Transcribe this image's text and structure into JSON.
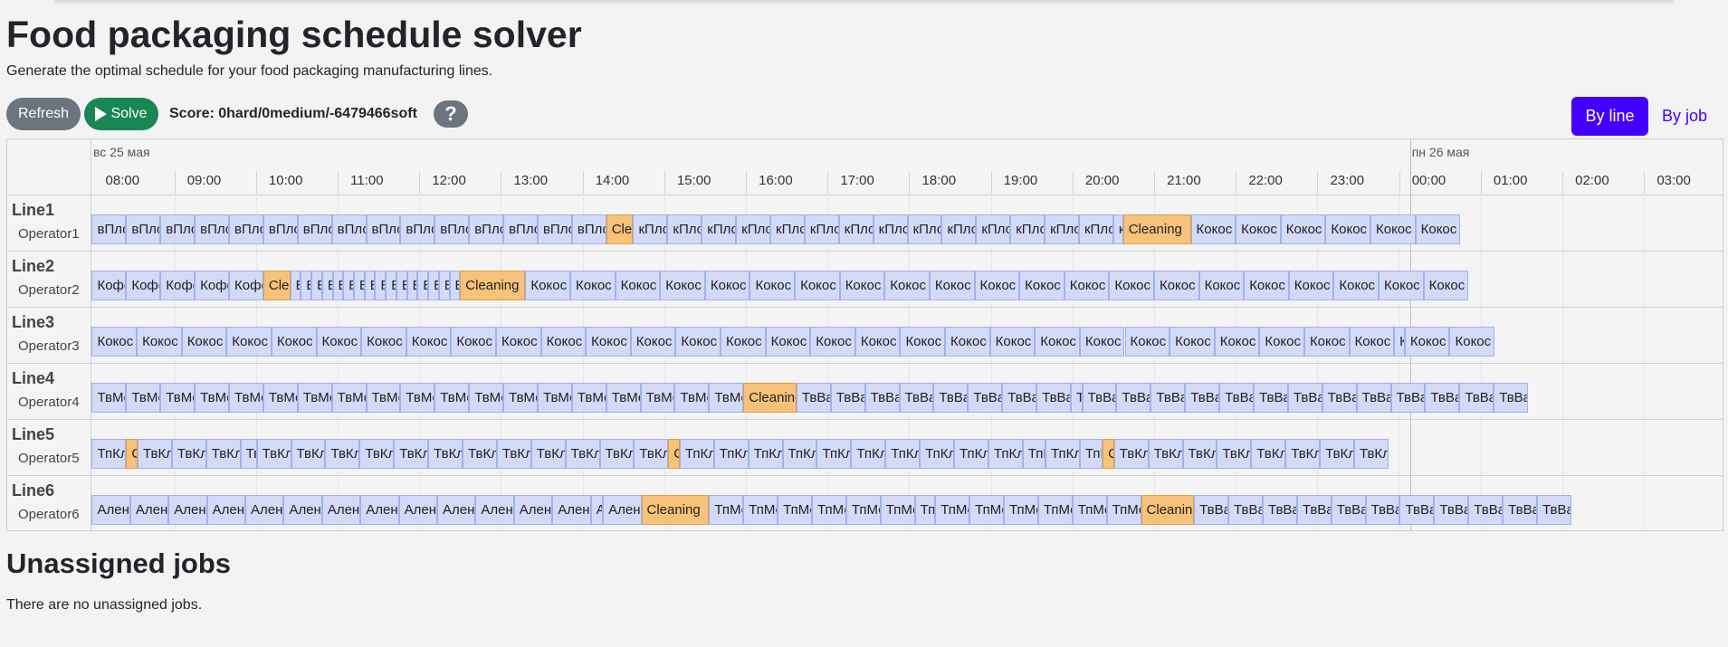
{
  "page": {
    "title": "Food packaging schedule solver",
    "subtitle": "Generate the optimal schedule for your food packaging manufacturing lines."
  },
  "toolbar": {
    "refresh_label": "Refresh",
    "solve_label": "Solve",
    "score": "Score: 0hard/0medium/-6479466soft",
    "help_label": "?",
    "by_line_label": "By line",
    "by_job_label": "By job"
  },
  "timeline": {
    "days": [
      {
        "label": "вс 25 мая"
      },
      {
        "label": "пн 26 мая"
      }
    ],
    "hours": [
      "08:00",
      "09:00",
      "10:00",
      "11:00",
      "12:00",
      "13:00",
      "14:00",
      "15:00",
      "16:00",
      "17:00",
      "18:00",
      "19:00",
      "20:00",
      "21:00",
      "22:00",
      "23:00",
      "00:00",
      "01:00",
      "02:00",
      "03:00"
    ],
    "lines": [
      {
        "name": "Line1",
        "operator": "Operator1",
        "start_hour": 7.7,
        "jobs": [
          [
            "вПлом",
            0.42
          ],
          [
            "вПлом",
            0.42
          ],
          [
            "вПлом",
            0.42
          ],
          [
            "вПлом",
            0.42
          ],
          [
            "вПлом",
            0.42
          ],
          [
            "вПлом",
            0.42
          ],
          [
            "вПлом",
            0.42
          ],
          [
            "вПлом",
            0.42
          ],
          [
            "вПлом",
            0.42
          ],
          [
            "вПлом",
            0.42
          ],
          [
            "вПлом",
            0.42
          ],
          [
            "вПлом",
            0.42
          ],
          [
            "вПлом",
            0.42
          ],
          [
            "вПлом",
            0.42
          ],
          [
            "вПлом",
            0.42
          ],
          [
            "Cleaning",
            0.33,
            true
          ],
          [
            "кПлом",
            0.42
          ],
          [
            "кПлом",
            0.42
          ],
          [
            "кПлом",
            0.42
          ],
          [
            "кПлом",
            0.42
          ],
          [
            "кПлом",
            0.42
          ],
          [
            "кПлом",
            0.42
          ],
          [
            "кПлом",
            0.42
          ],
          [
            "кПлом",
            0.42
          ],
          [
            "кПлом",
            0.42
          ],
          [
            "кПлом",
            0.42
          ],
          [
            "кПлом",
            0.42
          ],
          [
            "кПлом",
            0.42
          ],
          [
            "кПлом",
            0.42
          ],
          [
            "кПлом",
            0.42
          ],
          [
            "кПлом",
            0.12
          ],
          [
            "Cleaning",
            0.83,
            true
          ],
          [
            "Кокос",
            0.55
          ],
          [
            "Кокос",
            0.55
          ],
          [
            "Кокос",
            0.55
          ],
          [
            "Кокос",
            0.55
          ],
          [
            "Кокос",
            0.55
          ],
          [
            "Кокос",
            0.55
          ]
        ]
      },
      {
        "name": "Line2",
        "operator": "Operator2",
        "start_hour": 7.7,
        "jobs": [
          [
            "Кофе",
            0.42
          ],
          [
            "Кофе",
            0.42
          ],
          [
            "Кофе",
            0.42
          ],
          [
            "Кофе",
            0.42
          ],
          [
            "Кофе",
            0.42
          ],
          [
            "Cleaning",
            0.33,
            true
          ],
          [
            "В",
            0.13
          ],
          [
            "В",
            0.13
          ],
          [
            "В",
            0.13
          ],
          [
            "В",
            0.13
          ],
          [
            "В",
            0.13
          ],
          [
            "В",
            0.13
          ],
          [
            "В",
            0.13
          ],
          [
            "В",
            0.13
          ],
          [
            "В",
            0.13
          ],
          [
            "В",
            0.13
          ],
          [
            "В",
            0.13
          ],
          [
            "В",
            0.13
          ],
          [
            "В",
            0.13
          ],
          [
            "В",
            0.13
          ],
          [
            "В",
            0.13
          ],
          [
            "В",
            0.13
          ],
          [
            "Cleaning",
            0.8,
            true
          ],
          [
            "Кокос",
            0.55
          ],
          [
            "Кокос",
            0.55
          ],
          [
            "Кокос",
            0.55
          ],
          [
            "Кокос",
            0.55
          ],
          [
            "Кокос",
            0.55
          ],
          [
            "Кокос",
            0.55
          ],
          [
            "Кокос",
            0.55
          ],
          [
            "Кокос",
            0.55
          ],
          [
            "Кокос",
            0.55
          ],
          [
            "Кокос",
            0.55
          ],
          [
            "Кокос",
            0.55
          ],
          [
            "Кокос",
            0.55
          ],
          [
            "Кокос",
            0.55
          ],
          [
            "Кокос",
            0.55
          ],
          [
            "Кокос",
            0.55
          ],
          [
            "Кокос",
            0.55
          ],
          [
            "Кокос",
            0.55
          ],
          [
            "Кокос",
            0.55
          ],
          [
            "Кокос",
            0.55
          ],
          [
            "Кокос",
            0.55
          ],
          [
            "Кокос",
            0.55
          ]
        ]
      },
      {
        "name": "Line3",
        "operator": "Operator3",
        "start_hour": 7.7,
        "jobs": [
          [
            "Кокос",
            0.55
          ],
          [
            "Кокос",
            0.55
          ],
          [
            "Кокос",
            0.55
          ],
          [
            "Кокос",
            0.55
          ],
          [
            "Кокос",
            0.55
          ],
          [
            "Кокос",
            0.55
          ],
          [
            "Кокос",
            0.55
          ],
          [
            "Кокос",
            0.55
          ],
          [
            "Кокос",
            0.55
          ],
          [
            "Кокос",
            0.55
          ],
          [
            "Кокос",
            0.55
          ],
          [
            "Кокос",
            0.55
          ],
          [
            "Кокос",
            0.55
          ],
          [
            "Кокос",
            0.55
          ],
          [
            "Кокос",
            0.55
          ],
          [
            "Кокос",
            0.55
          ],
          [
            "Кокос",
            0.55
          ],
          [
            "Кокос",
            0.55
          ],
          [
            "Кокос",
            0.55
          ],
          [
            "Кокос",
            0.55
          ],
          [
            "Кокос",
            0.55
          ],
          [
            "Кокос",
            0.55
          ],
          [
            "Кокос",
            0.55
          ],
          [
            "Кокос",
            0.55
          ],
          [
            "Кокос",
            0.55
          ],
          [
            "Кокос",
            0.55
          ],
          [
            "Кокос",
            0.55
          ],
          [
            "Кокос",
            0.55
          ],
          [
            "Кокос",
            0.55
          ],
          [
            "Кокос",
            0.13
          ],
          [
            "Кокос",
            0.55
          ],
          [
            "Кокос",
            0.55
          ]
        ]
      },
      {
        "name": "Line4",
        "operator": "Operator4",
        "start_hour": 7.7,
        "jobs": [
          [
            "ТвМол",
            0.42
          ],
          [
            "ТвМол",
            0.42
          ],
          [
            "ТвМол",
            0.42
          ],
          [
            "ТвМол",
            0.42
          ],
          [
            "ТвМол",
            0.42
          ],
          [
            "ТвМол",
            0.42
          ],
          [
            "ТвМол",
            0.42
          ],
          [
            "ТвМол",
            0.42
          ],
          [
            "ТвМол",
            0.42
          ],
          [
            "ТвМол",
            0.42
          ],
          [
            "ТвМол",
            0.42
          ],
          [
            "ТвМол",
            0.42
          ],
          [
            "ТвМол",
            0.42
          ],
          [
            "ТвМол",
            0.42
          ],
          [
            "ТвМол",
            0.42
          ],
          [
            "ТвМол",
            0.42
          ],
          [
            "ТвМол",
            0.42
          ],
          [
            "ТвМол",
            0.42
          ],
          [
            "ТвМол",
            0.42
          ],
          [
            "Cleaning",
            0.65,
            true
          ],
          [
            "ТвВан",
            0.42
          ],
          [
            "ТвВан",
            0.42
          ],
          [
            "ТвВан",
            0.42
          ],
          [
            "ТвВан",
            0.42
          ],
          [
            "ТвВан",
            0.42
          ],
          [
            "ТвВан",
            0.42
          ],
          [
            "ТвВан",
            0.42
          ],
          [
            "ТвВан",
            0.42
          ],
          [
            "ТвВан",
            0.14
          ],
          [
            "ТвВан",
            0.42
          ],
          [
            "ТвВан",
            0.42
          ],
          [
            "ТвВан",
            0.42
          ],
          [
            "ТвВан",
            0.42
          ],
          [
            "ТвВан",
            0.42
          ],
          [
            "ТвВан",
            0.42
          ],
          [
            "ТвВан",
            0.42
          ],
          [
            "ТвВан",
            0.42
          ],
          [
            "ТвВан",
            0.42
          ],
          [
            "ТвВан",
            0.42
          ],
          [
            "ТвВан",
            0.42
          ],
          [
            "ТвВан",
            0.42
          ],
          [
            "ТвВан",
            0.42
          ]
        ]
      },
      {
        "name": "Line5",
        "operator": "Operator5",
        "start_hour": 7.7,
        "jobs": [
          [
            "ТпКл",
            0.42
          ],
          [
            "Cleaning",
            0.14,
            true
          ],
          [
            "ТвКл",
            0.42
          ],
          [
            "ТвКл",
            0.42
          ],
          [
            "ТвКл",
            0.42
          ],
          [
            "ТвКл",
            0.2
          ],
          [
            "ТвКл",
            0.42
          ],
          [
            "ТвКл",
            0.42
          ],
          [
            "ТвКл",
            0.42
          ],
          [
            "ТвКл",
            0.42
          ],
          [
            "ТвКл",
            0.42
          ],
          [
            "ТвКл",
            0.42
          ],
          [
            "ТвКл",
            0.42
          ],
          [
            "ТвКл",
            0.42
          ],
          [
            "ТвКл",
            0.42
          ],
          [
            "ТвКл",
            0.42
          ],
          [
            "ТвКл",
            0.42
          ],
          [
            "ТвКл",
            0.42
          ],
          [
            "Cleaning",
            0.14,
            true
          ],
          [
            "ТпКл",
            0.42
          ],
          [
            "ТпКл",
            0.42
          ],
          [
            "ТпКл",
            0.42
          ],
          [
            "ТпКл",
            0.42
          ],
          [
            "ТпКл",
            0.42
          ],
          [
            "ТпКл",
            0.42
          ],
          [
            "ТпКл",
            0.42
          ],
          [
            "ТпКл",
            0.42
          ],
          [
            "ТпКл",
            0.42
          ],
          [
            "ТпКл",
            0.42
          ],
          [
            "ТпКл",
            0.28
          ],
          [
            "ТпКл",
            0.42
          ],
          [
            "ТпКл",
            0.28
          ],
          [
            "Cleaning",
            0.14,
            true
          ],
          [
            "ТвКл",
            0.42
          ],
          [
            "ТвКл",
            0.42
          ],
          [
            "ТвКл",
            0.42
          ],
          [
            "ТвКл",
            0.42
          ],
          [
            "ТвКл",
            0.42
          ],
          [
            "ТвКл",
            0.42
          ],
          [
            "ТвКл",
            0.42
          ],
          [
            "ТвКл",
            0.42
          ]
        ]
      },
      {
        "name": "Line6",
        "operator": "Operator6",
        "start_hour": 7.7,
        "jobs": [
          [
            "Аленка",
            0.47
          ],
          [
            "Аленка",
            0.47
          ],
          [
            "Аленка",
            0.47
          ],
          [
            "Аленка",
            0.47
          ],
          [
            "Аленка",
            0.47
          ],
          [
            "Аленка",
            0.47
          ],
          [
            "Аленка",
            0.47
          ],
          [
            "Аленка",
            0.47
          ],
          [
            "Аленка",
            0.47
          ],
          [
            "Аленка",
            0.47
          ],
          [
            "Аленка",
            0.47
          ],
          [
            "Аленка",
            0.47
          ],
          [
            "Аленка",
            0.47
          ],
          [
            "Аленка",
            0.15
          ],
          [
            "Аленка",
            0.47
          ],
          [
            "Cleaning",
            0.83,
            true
          ],
          [
            "ТпМол",
            0.42
          ],
          [
            "ТпМол",
            0.42
          ],
          [
            "ТпМол",
            0.42
          ],
          [
            "ТпМол",
            0.42
          ],
          [
            "ТпМол",
            0.42
          ],
          [
            "ТпМол",
            0.42
          ],
          [
            "ТпМол",
            0.25
          ],
          [
            "ТпМол",
            0.42
          ],
          [
            "ТпМол",
            0.42
          ],
          [
            "ТпМол",
            0.42
          ],
          [
            "ТпМол",
            0.42
          ],
          [
            "ТпМол",
            0.42
          ],
          [
            "ТпМол",
            0.42
          ],
          [
            "Cleaning",
            0.65,
            true
          ],
          [
            "ТвВан",
            0.42
          ],
          [
            "ТвВан",
            0.42
          ],
          [
            "ТвВан",
            0.42
          ],
          [
            "ТвВан",
            0.42
          ],
          [
            "ТвВан",
            0.42
          ],
          [
            "ТвВан",
            0.42
          ],
          [
            "ТвВан",
            0.42
          ],
          [
            "ТвВан",
            0.42
          ],
          [
            "ТвВан",
            0.42
          ],
          [
            "ТвВан",
            0.42
          ],
          [
            "ТвВан",
            0.42
          ]
        ]
      }
    ]
  },
  "unassigned": {
    "title": "Unassigned jobs",
    "text": "There are no unassigned jobs."
  }
}
